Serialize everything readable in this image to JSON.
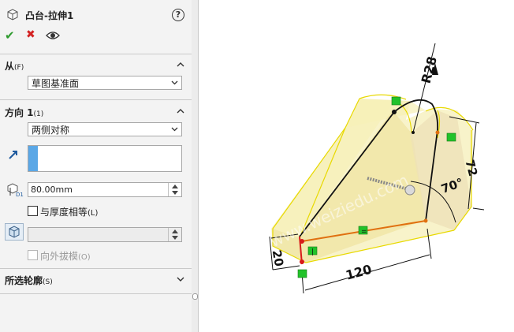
{
  "feature": {
    "title": "凸台-拉伸1",
    "help_symbol": "?",
    "ok_symbol": "✔",
    "cancel_symbol": "✖"
  },
  "from_section": {
    "title": "从",
    "hotkey": "(F)",
    "selected": "草图基准面"
  },
  "direction_section": {
    "title": "方向 1",
    "hotkey": "(1)",
    "end_condition": "两侧对称",
    "depth_value": "80.00mm",
    "merge_thickness_label": "与厚度相等",
    "merge_thickness_hotkey": "(L)",
    "draft_outward_label": "向外拔模",
    "draft_outward_hotkey": "(O)"
  },
  "contours_section": {
    "title": "所选轮廓",
    "hotkey": "(S)"
  },
  "drawing": {
    "dim_radius": "R28",
    "dim_height": "72",
    "dim_angle": "70°",
    "dim_length": "120",
    "dim_thickness": "20",
    "relation_parallel": "=",
    "relation_vertical": "|",
    "watermark": "www.weiziedu.com"
  },
  "colors": {
    "face_yellow": "#f3e99e",
    "edge_yellow": "#e8d900",
    "accent_orange": "#e07010",
    "relation_green": "#22c22a"
  }
}
